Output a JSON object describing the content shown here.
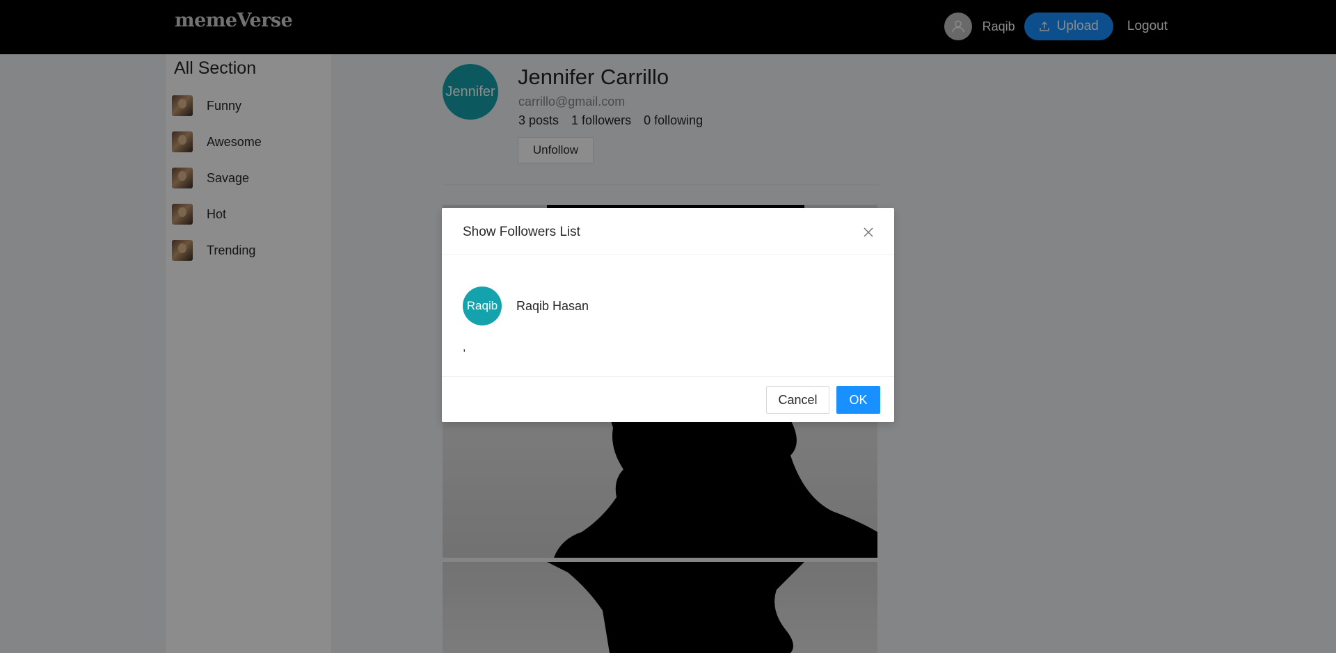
{
  "header": {
    "logo": "memeVerse",
    "user_name": "Raqib",
    "upload_label": "Upload",
    "logout_label": "Logout"
  },
  "sidebar": {
    "title": "All Section",
    "items": [
      {
        "label": "Funny"
      },
      {
        "label": "Awesome"
      },
      {
        "label": "Savage"
      },
      {
        "label": "Hot"
      },
      {
        "label": "Trending"
      }
    ]
  },
  "profile": {
    "avatar_text": "Jennifer",
    "name": "Jennifer Carrillo",
    "email": "carrillo@gmail.com",
    "posts": "3 posts",
    "followers": "1 followers",
    "following": "0 following",
    "unfollow_label": "Unfollow"
  },
  "modal": {
    "title": "Show Followers List",
    "followers": [
      {
        "avatar_text": "Raqib",
        "name": "Raqib Hasan"
      }
    ],
    "stray_text": ",",
    "cancel_label": "Cancel",
    "ok_label": "OK"
  },
  "colors": {
    "header_bg": "#000000",
    "primary": "#1890ff",
    "avatar_teal": "#14a3ac"
  }
}
